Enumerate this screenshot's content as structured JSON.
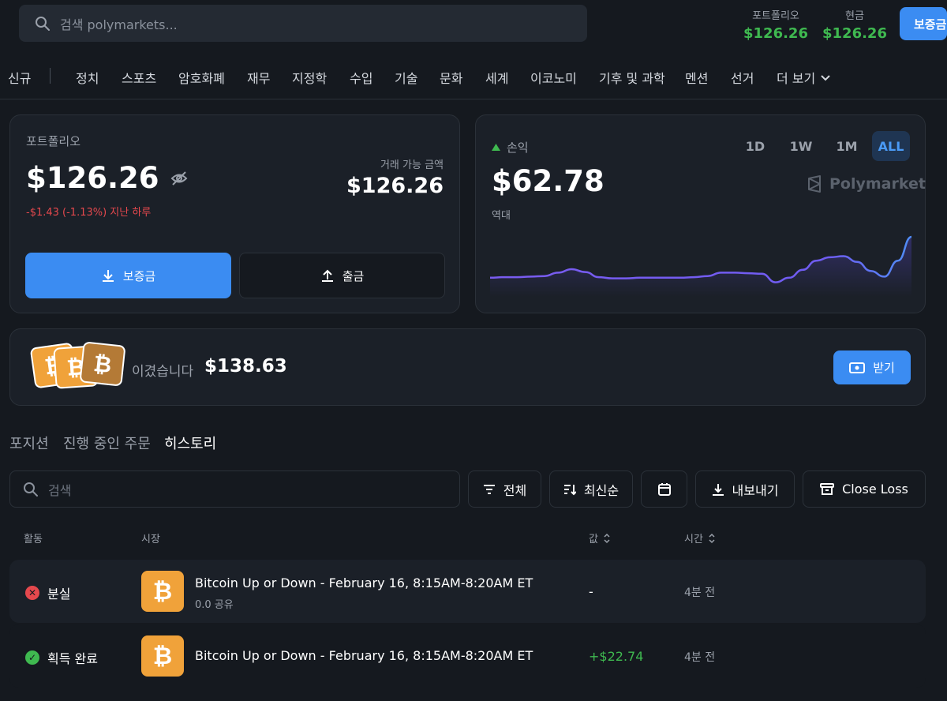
{
  "header": {
    "search_placeholder": "검색 polymarkets...",
    "portfolio_label": "포트폴리오",
    "portfolio_value": "$126.26",
    "cash_label": "현금",
    "cash_value": "$126.26",
    "deposit_label": "보증금"
  },
  "nav": {
    "items": [
      "신규",
      "정치",
      "스포츠",
      "암호화폐",
      "재무",
      "지정학",
      "수입",
      "기술",
      "문화",
      "세계",
      "이코노미",
      "기후 및 과학",
      "멘션",
      "선거",
      "더 보기"
    ]
  },
  "portfolio": {
    "title": "포트폴리오",
    "value": "$126.26",
    "change": "-$1.43 (-1.13%) 지난 하루",
    "tradable_label": "거래 가능 금액",
    "tradable_value": "$126.26",
    "deposit_label": "보증금",
    "withdraw_label": "출금"
  },
  "pnl": {
    "label": "손익",
    "value": "$62.78",
    "period_label": "역대",
    "brand": "Polymarket",
    "ranges": [
      "1D",
      "1W",
      "1M",
      "ALL"
    ],
    "active_range": "ALL",
    "series": [
      0.28,
      0.29,
      0.29,
      0.3,
      0.31,
      0.37,
      0.43,
      0.38,
      0.29,
      0.27,
      0.27,
      0.28,
      0.28,
      0.28,
      0.28,
      0.29,
      0.31,
      0.37,
      0.37,
      0.36,
      0.35,
      0.2,
      0.28,
      0.42,
      0.58,
      0.64,
      0.66,
      0.56,
      0.4,
      0.3,
      0.58,
      1.0
    ]
  },
  "won": {
    "label": "이겼습니다",
    "amount": "$138.63",
    "claim_label": "받기"
  },
  "tabs": [
    "포지션",
    "진행 중인 주문",
    "히스토리"
  ],
  "active_tab": "히스토리",
  "toolbar": {
    "search_placeholder": "검색",
    "filter_label": "전체",
    "sort_label": "최신순",
    "export_label": "내보내기",
    "close_loss_label": "Close Loss"
  },
  "table": {
    "headers": {
      "activity": "활동",
      "market": "시장",
      "value": "값",
      "time": "시간"
    },
    "rows": [
      {
        "status": "분실",
        "status_color": "#e5484d",
        "market": "Bitcoin Up or Down - February 16, 8:15AM-8:20AM ET",
        "sub": "0.0 공유",
        "value": "-",
        "time": "4분 전"
      },
      {
        "status": "획득 완료",
        "status_color": "#3fb950",
        "market": "Bitcoin Up or Down - February 16, 8:15AM-8:20AM ET",
        "sub": "",
        "value": "+$22.74",
        "time": "4분 전"
      }
    ]
  }
}
